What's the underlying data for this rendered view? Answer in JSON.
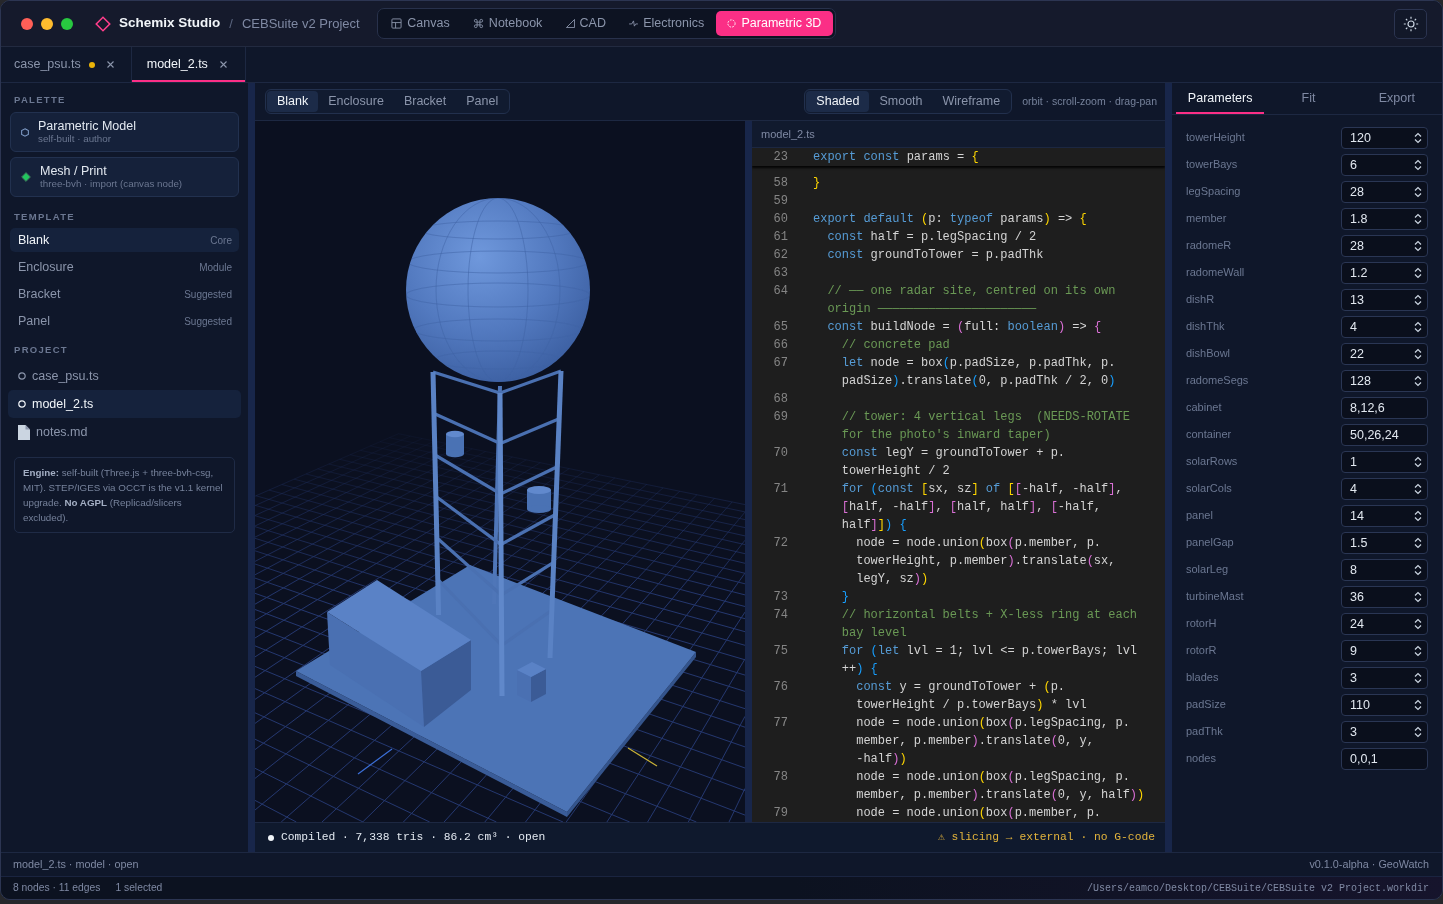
{
  "window": {
    "app_name": "Schemix Studio",
    "separator": "/",
    "project": "CEBSuite v2 Project"
  },
  "modes": [
    {
      "label": "Canvas",
      "kind": "canvas",
      "selected": false
    },
    {
      "label": "Notebook",
      "kind": "notebook",
      "selected": false
    },
    {
      "label": "CAD",
      "kind": "cad",
      "selected": false
    },
    {
      "label": "Electronics",
      "kind": "electronics",
      "selected": false
    },
    {
      "label": "Parametric 3D",
      "kind": "parametric",
      "selected": true
    }
  ],
  "file_tabs": [
    {
      "label": "case_psu.ts",
      "modified": true,
      "selected": false
    },
    {
      "label": "model_2.ts",
      "modified": false,
      "selected": true
    }
  ],
  "sidebar": {
    "palette": {
      "title": "PALETTE",
      "items": [
        {
          "name": "Parametric Model",
          "detail": "self-built · author",
          "kind": "parametric"
        },
        {
          "name": "Mesh / Print",
          "detail": "three-bvh · import (canvas node)",
          "kind": "mesh"
        }
      ]
    },
    "template": {
      "title": "TEMPLATE",
      "items": [
        {
          "name": "Blank",
          "tag": "Core",
          "selected": true
        },
        {
          "name": "Enclosure",
          "tag": "Module",
          "selected": false
        },
        {
          "name": "Bracket",
          "tag": "Suggested",
          "selected": false
        },
        {
          "name": "Panel",
          "tag": "Suggested",
          "selected": false
        }
      ]
    },
    "project": {
      "title": "PROJECT",
      "items": [
        {
          "name": "case_psu.ts",
          "kind": "model",
          "selected": false
        },
        {
          "name": "model_2.ts",
          "kind": "model",
          "selected": true
        },
        {
          "name": "notes.md",
          "kind": "document",
          "selected": false
        }
      ]
    },
    "note": "**Engine:** self-built (Three.js + three-bvh-csg, MIT). STEP/IGES via OCCT is the v1.1 kernel upgrade. **No AGPL** (Replicad/slicers excluded)."
  },
  "viewport": {
    "templates": [
      {
        "label": "Blank",
        "selected": true
      },
      {
        "label": "Enclosure",
        "selected": false
      },
      {
        "label": "Bracket",
        "selected": false
      },
      {
        "label": "Panel",
        "selected": false
      }
    ],
    "shading": [
      {
        "label": "Shaded",
        "selected": true
      },
      {
        "label": "Smooth",
        "selected": false
      },
      {
        "label": "Wireframe",
        "selected": false
      }
    ],
    "hint": "orbit · scroll-zoom · drag-pan",
    "status": "Compiled · 7,338 tris · 86.2 cm³ · open",
    "warning": "⚠ slicing → external · no G-code"
  },
  "editor": {
    "filename": "model_2.ts",
    "sticky_line": {
      "number": "23",
      "rows": [
        {
          "tokens": [
            {
              "kind": "keyword",
              "text": "export"
            },
            {
              "kind": "keyword",
              "text": " const"
            },
            {
              "kind": "plain",
              "text": " params = "
            },
            {
              "kind": "bracket1",
              "text": "{"
            }
          ]
        }
      ]
    },
    "lines": [
      {
        "number": "58",
        "rows": [
          {
            "tokens": [
              {
                "kind": "bracket1",
                "text": "}"
              }
            ]
          }
        ]
      },
      {
        "number": "59"
      },
      {
        "number": "60",
        "rows": [
          {
            "tokens": [
              {
                "kind": "keyword",
                "text": "export"
              },
              {
                "kind": "keyword",
                "text": " default"
              },
              {
                "kind": "bracket1",
                "text": " ("
              },
              {
                "kind": "plain",
                "text": "p: "
              },
              {
                "kind": "keyword",
                "text": "typeof"
              },
              {
                "kind": "plain",
                "text": " params"
              },
              {
                "kind": "bracket1",
                "text": ")"
              },
              {
                "kind": "plain",
                "text": " => "
              },
              {
                "kind": "bracket1",
                "text": "{"
              }
            ]
          }
        ]
      },
      {
        "number": "61",
        "rows": [
          {
            "tokens": [
              {
                "kind": "keyword",
                "text": "  const"
              },
              {
                "kind": "plain",
                "text": " half = p.legSpacing / 2"
              }
            ]
          }
        ]
      },
      {
        "number": "62",
        "rows": [
          {
            "tokens": [
              {
                "kind": "keyword",
                "text": "  const"
              },
              {
                "kind": "plain",
                "text": " groundToTower = p.padThk"
              }
            ]
          }
        ]
      },
      {
        "number": "63"
      },
      {
        "number": "64",
        "rows": [
          {
            "tokens": [
              {
                "kind": "comment",
                "text": "  // —— one radar site, centred on its own"
              }
            ]
          },
          {
            "tokens": [
              {
                "kind": "comment",
                "text": "  origin ——————————————————————"
              }
            ]
          }
        ]
      },
      {
        "number": "65",
        "rows": [
          {
            "tokens": [
              {
                "kind": "keyword",
                "text": "  const"
              },
              {
                "kind": "plain",
                "text": " buildNode = "
              },
              {
                "kind": "bracket2",
                "text": "("
              },
              {
                "kind": "plain",
                "text": "full: "
              },
              {
                "kind": "keyword",
                "text": "boolean"
              },
              {
                "kind": "bracket2",
                "text": ")"
              },
              {
                "kind": "plain",
                "text": " => "
              },
              {
                "kind": "bracket2",
                "text": "{"
              }
            ]
          }
        ]
      },
      {
        "number": "66",
        "rows": [
          {
            "tokens": [
              {
                "kind": "comment",
                "text": "    // concrete pad"
              }
            ]
          }
        ]
      },
      {
        "number": "67",
        "rows": [
          {
            "tokens": [
              {
                "kind": "keyword",
                "text": "    let"
              },
              {
                "kind": "plain",
                "text": " node = box"
              },
              {
                "kind": "bracket3",
                "text": "("
              },
              {
                "kind": "plain",
                "text": "p.padSize, p.padThk, p."
              }
            ]
          },
          {
            "tokens": [
              {
                "kind": "plain",
                "text": "    padSize"
              },
              {
                "kind": "bracket3",
                "text": ")"
              },
              {
                "kind": "plain",
                "text": ".translate"
              },
              {
                "kind": "bracket3",
                "text": "("
              },
              {
                "kind": "plain",
                "text": "0, p.padThk / 2, 0"
              },
              {
                "kind": "bracket3",
                "text": ")"
              }
            ]
          }
        ]
      },
      {
        "number": "68"
      },
      {
        "number": "69",
        "rows": [
          {
            "tokens": [
              {
                "kind": "comment",
                "text": "    // tower: 4 vertical legs  (NEEDS-ROTATE"
              }
            ]
          },
          {
            "tokens": [
              {
                "kind": "comment",
                "text": "    for the photo's inward taper)"
              }
            ]
          }
        ]
      },
      {
        "number": "70",
        "rows": [
          {
            "tokens": [
              {
                "kind": "keyword",
                "text": "    const"
              },
              {
                "kind": "plain",
                "text": " legY = groundToTower + p."
              }
            ]
          },
          {
            "tokens": [
              {
                "kind": "plain",
                "text": "    towerHeight / 2"
              }
            ]
          }
        ]
      },
      {
        "number": "71",
        "rows": [
          {
            "tokens": [
              {
                "kind": "keyword",
                "text": "    for"
              },
              {
                "kind": "bracket3",
                "text": " ("
              },
              {
                "kind": "keyword",
                "text": "const"
              },
              {
                "kind": "bracket1",
                "text": " ["
              },
              {
                "kind": "plain",
                "text": "sx, sz"
              },
              {
                "kind": "bracket1",
                "text": "]"
              },
              {
                "kind": "keyword",
                "text": " of"
              },
              {
                "kind": "bracket1",
                "text": " ["
              },
              {
                "kind": "bracket2",
                "text": "["
              },
              {
                "kind": "plain",
                "text": "-half, -half"
              },
              {
                "kind": "bracket2",
                "text": "]"
              },
              {
                "kind": "plain",
                "text": ","
              }
            ]
          },
          {
            "tokens": [
              {
                "kind": "bracket2",
                "text": "    ["
              },
              {
                "kind": "plain",
                "text": "half, -half"
              },
              {
                "kind": "bracket2",
                "text": "]"
              },
              {
                "kind": "plain",
                "text": ", "
              },
              {
                "kind": "bracket2",
                "text": "["
              },
              {
                "kind": "plain",
                "text": "half, half"
              },
              {
                "kind": "bracket2",
                "text": "]"
              },
              {
                "kind": "plain",
                "text": ", "
              },
              {
                "kind": "bracket2",
                "text": "["
              },
              {
                "kind": "plain",
                "text": "-half,"
              }
            ]
          },
          {
            "tokens": [
              {
                "kind": "plain",
                "text": "    half"
              },
              {
                "kind": "bracket2",
                "text": "]"
              },
              {
                "kind": "bracket1",
                "text": "]"
              },
              {
                "kind": "bracket3",
                "text": ")"
              },
              {
                "kind": "bracket3",
                "text": " {"
              }
            ]
          }
        ]
      },
      {
        "number": "72",
        "rows": [
          {
            "tokens": [
              {
                "kind": "plain",
                "text": "      node = node.union"
              },
              {
                "kind": "bracket1",
                "text": "("
              },
              {
                "kind": "plain",
                "text": "box"
              },
              {
                "kind": "bracket2",
                "text": "("
              },
              {
                "kind": "plain",
                "text": "p.member, p."
              }
            ]
          },
          {
            "tokens": [
              {
                "kind": "plain",
                "text": "      towerHeight, p.member"
              },
              {
                "kind": "bracket2",
                "text": ")"
              },
              {
                "kind": "plain",
                "text": ".translate"
              },
              {
                "kind": "bracket2",
                "text": "("
              },
              {
                "kind": "plain",
                "text": "sx,"
              }
            ]
          },
          {
            "tokens": [
              {
                "kind": "plain",
                "text": "      legY, sz"
              },
              {
                "kind": "bracket2",
                "text": ")"
              },
              {
                "kind": "bracket1",
                "text": ")"
              }
            ]
          }
        ]
      },
      {
        "number": "73",
        "rows": [
          {
            "tokens": [
              {
                "kind": "bracket3",
                "text": "    }"
              }
            ]
          }
        ]
      },
      {
        "number": "74",
        "rows": [
          {
            "tokens": [
              {
                "kind": "comment",
                "text": "    // horizontal belts + X-less ring at each"
              }
            ]
          },
          {
            "tokens": [
              {
                "kind": "comment",
                "text": "    bay level"
              }
            ]
          }
        ]
      },
      {
        "number": "75",
        "rows": [
          {
            "tokens": [
              {
                "kind": "keyword",
                "text": "    for"
              },
              {
                "kind": "bracket3",
                "text": " ("
              },
              {
                "kind": "keyword",
                "text": "let"
              },
              {
                "kind": "plain",
                "text": " lvl = 1; lvl <= p.towerBays; lvl"
              }
            ]
          },
          {
            "tokens": [
              {
                "kind": "plain",
                "text": "    ++"
              },
              {
                "kind": "bracket3",
                "text": ")"
              },
              {
                "kind": "bracket3",
                "text": " {"
              }
            ]
          }
        ]
      },
      {
        "number": "76",
        "rows": [
          {
            "tokens": [
              {
                "kind": "keyword",
                "text": "      const"
              },
              {
                "kind": "plain",
                "text": " y = groundToTower + "
              },
              {
                "kind": "bracket1",
                "text": "("
              },
              {
                "kind": "plain",
                "text": "p."
              }
            ]
          },
          {
            "tokens": [
              {
                "kind": "plain",
                "text": "      towerHeight / p.towerBays"
              },
              {
                "kind": "bracket1",
                "text": ")"
              },
              {
                "kind": "plain",
                "text": " * lvl"
              }
            ]
          }
        ]
      },
      {
        "number": "77",
        "rows": [
          {
            "tokens": [
              {
                "kind": "plain",
                "text": "      node = node.union"
              },
              {
                "kind": "bracket1",
                "text": "("
              },
              {
                "kind": "plain",
                "text": "box"
              },
              {
                "kind": "bracket2",
                "text": "("
              },
              {
                "kind": "plain",
                "text": "p.legSpacing, p."
              }
            ]
          },
          {
            "tokens": [
              {
                "kind": "plain",
                "text": "      member, p.member"
              },
              {
                "kind": "bracket2",
                "text": ")"
              },
              {
                "kind": "plain",
                "text": ".translate"
              },
              {
                "kind": "bracket2",
                "text": "("
              },
              {
                "kind": "plain",
                "text": "0, y,"
              }
            ]
          },
          {
            "tokens": [
              {
                "kind": "plain",
                "text": "      -half"
              },
              {
                "kind": "bracket2",
                "text": ")"
              },
              {
                "kind": "bracket1",
                "text": ")"
              }
            ]
          }
        ]
      },
      {
        "number": "78",
        "rows": [
          {
            "tokens": [
              {
                "kind": "plain",
                "text": "      node = node.union"
              },
              {
                "kind": "bracket1",
                "text": "("
              },
              {
                "kind": "plain",
                "text": "box"
              },
              {
                "kind": "bracket2",
                "text": "("
              },
              {
                "kind": "plain",
                "text": "p.legSpacing, p."
              }
            ]
          },
          {
            "tokens": [
              {
                "kind": "plain",
                "text": "      member, p.member"
              },
              {
                "kind": "bracket2",
                "text": ")"
              },
              {
                "kind": "plain",
                "text": ".translate"
              },
              {
                "kind": "bracket2",
                "text": "("
              },
              {
                "kind": "plain",
                "text": "0, y, half"
              },
              {
                "kind": "bracket2",
                "text": ")"
              },
              {
                "kind": "bracket1",
                "text": ")"
              }
            ]
          }
        ]
      },
      {
        "number": "79",
        "rows": [
          {
            "tokens": [
              {
                "kind": "plain",
                "text": "      node = node.union"
              },
              {
                "kind": "bracket1",
                "text": "("
              },
              {
                "kind": "plain",
                "text": "box"
              },
              {
                "kind": "bracket2",
                "text": "("
              },
              {
                "kind": "plain",
                "text": "p.member, p."
              }
            ]
          }
        ]
      }
    ]
  },
  "inspector": {
    "tabs": [
      {
        "label": "Parameters",
        "selected": true
      },
      {
        "label": "Fit",
        "selected": false
      },
      {
        "label": "Export",
        "selected": false
      }
    ],
    "parameters": [
      {
        "name": "towerHeight",
        "value": "120",
        "kind": "number"
      },
      {
        "name": "towerBays",
        "value": "6",
        "kind": "number"
      },
      {
        "name": "legSpacing",
        "value": "28",
        "kind": "number"
      },
      {
        "name": "member",
        "value": "1.8",
        "kind": "number"
      },
      {
        "name": "radomeR",
        "value": "28",
        "kind": "number"
      },
      {
        "name": "radomeWall",
        "value": "1.2",
        "kind": "number"
      },
      {
        "name": "dishR",
        "value": "13",
        "kind": "number"
      },
      {
        "name": "dishThk",
        "value": "4",
        "kind": "number"
      },
      {
        "name": "dishBowl",
        "value": "22",
        "kind": "number"
      },
      {
        "name": "radomeSegs",
        "value": "128",
        "kind": "number"
      },
      {
        "name": "cabinet",
        "value": "8,12,6",
        "kind": "text"
      },
      {
        "name": "container",
        "value": "50,26,24",
        "kind": "text"
      },
      {
        "name": "solarRows",
        "value": "1",
        "kind": "number"
      },
      {
        "name": "solarCols",
        "value": "4",
        "kind": "number"
      },
      {
        "name": "panel",
        "value": "14",
        "kind": "number"
      },
      {
        "name": "panelGap",
        "value": "1.5",
        "kind": "number"
      },
      {
        "name": "solarLeg",
        "value": "8",
        "kind": "number"
      },
      {
        "name": "turbineMast",
        "value": "36",
        "kind": "number"
      },
      {
        "name": "rotorH",
        "value": "24",
        "kind": "number"
      },
      {
        "name": "rotorR",
        "value": "9",
        "kind": "number"
      },
      {
        "name": "blades",
        "value": "3",
        "kind": "number"
      },
      {
        "name": "padSize",
        "value": "110",
        "kind": "number"
      },
      {
        "name": "padThk",
        "value": "3",
        "kind": "number"
      },
      {
        "name": "nodes",
        "value": "0,0,1",
        "kind": "text"
      }
    ]
  },
  "status_bar": {
    "file": "model_2.ts · model · open",
    "version": "v0.1.0-alpha · GeoWatch"
  },
  "footer": {
    "graph": "8 nodes · 11 edges",
    "selection": "1 selected",
    "path": "/Users/eamco/Desktop/CEBSuite/CEBSuite v2 Project.workdir"
  }
}
